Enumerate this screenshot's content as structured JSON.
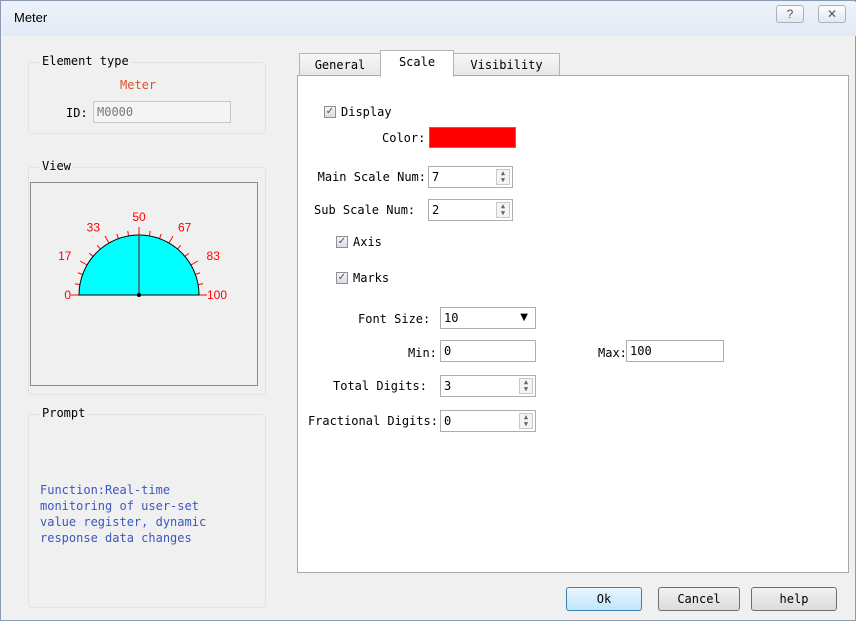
{
  "window": {
    "title": "Meter",
    "help_glyph": "?",
    "close_glyph": "✕"
  },
  "element_type": {
    "group_label": "Element type",
    "type_name": "Meter",
    "id_label": "ID:",
    "id_value": "M0000"
  },
  "view": {
    "group_label": "View",
    "meter": {
      "min": 0,
      "max": 100,
      "tick_labels": [
        "0",
        "17",
        "33",
        "50",
        "67",
        "83",
        "100"
      ],
      "face_color": "#00ffff",
      "label_color": "#ff0000"
    }
  },
  "prompt": {
    "group_label": "Prompt",
    "text_lines": [
      "Function:Real-time",
      "monitoring of user-set",
      "value register, dynamic",
      "response data changes"
    ]
  },
  "tabs": [
    {
      "label": "General",
      "active": false
    },
    {
      "label": "Scale",
      "active": true
    },
    {
      "label": "Visibility",
      "active": false
    }
  ],
  "scale": {
    "display_label": "Display",
    "display_checked": true,
    "color_label": "Color:",
    "color_value": "#ff0000",
    "main_scale_label": "Main Scale Num:",
    "main_scale_value": "7",
    "sub_scale_label": "Sub Scale Num:",
    "sub_scale_value": "2",
    "axis_label": "Axis",
    "axis_checked": true,
    "marks_label": "Marks",
    "marks_checked": true,
    "font_size_label": "Font Size:",
    "font_size_value": "10",
    "min_label": "Min:",
    "min_value": "0",
    "max_label": "Max:",
    "max_value": "100",
    "total_digits_label": "Total Digits:",
    "total_digits_value": "3",
    "fractional_digits_label": "Fractional Digits:",
    "fractional_digits_value": "0"
  },
  "buttons": {
    "ok": "Ok",
    "cancel": "Cancel",
    "help": "help"
  }
}
